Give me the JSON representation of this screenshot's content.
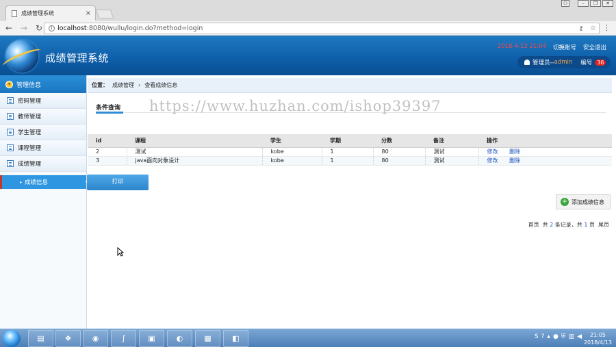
{
  "browser": {
    "tab_title": "成绩管理系统",
    "url_host": "localhost",
    "url_rest": ":8080/wullu/login.do?method=login"
  },
  "header": {
    "system_title": "成绩管理系统",
    "date_text": "2018-4-13 21:04",
    "switch_account": "切换账号",
    "logout": "安全退出",
    "user_role": "管理员--",
    "user_name": "admin",
    "id_label": "编号",
    "id_value": "36"
  },
  "sidebar": {
    "title": "管理信息",
    "items": [
      {
        "label": "密码管理"
      },
      {
        "label": "教师管理"
      },
      {
        "label": "学生管理"
      },
      {
        "label": "课程管理"
      },
      {
        "label": "成绩管理"
      }
    ],
    "active_sub": "成绩信息"
  },
  "breadcrumb": {
    "label": "位置：",
    "path1": "成绩管理",
    "sep": "›",
    "path2": "查看成绩信息"
  },
  "filter": {
    "tab": "条件查询"
  },
  "watermark": "https://www.huzhan.com/ishop39397",
  "table": {
    "headers": [
      "id",
      "课程",
      "学生",
      "学期",
      "分数",
      "备注",
      "操作"
    ],
    "rows": [
      {
        "id": "2",
        "course": "测试",
        "student": "kobe",
        "term": "1",
        "score": "80",
        "note": "测试",
        "edit": "修改",
        "delete": "删除"
      },
      {
        "id": "3",
        "course": "java面向对象设计",
        "student": "kobe",
        "term": "1",
        "score": "80",
        "note": "测试",
        "edit": "修改",
        "delete": "删除"
      }
    ]
  },
  "actions": {
    "print": "打印",
    "add": "添加成绩信息"
  },
  "pager": {
    "first": "首页",
    "total_prefix": "共",
    "total": "2",
    "total_suffix": "条记录，共",
    "pages": "1",
    "pages_suffix": "页",
    "last": "尾页"
  },
  "taskbar": {
    "time": "21:05",
    "date": "2018/4/13"
  }
}
